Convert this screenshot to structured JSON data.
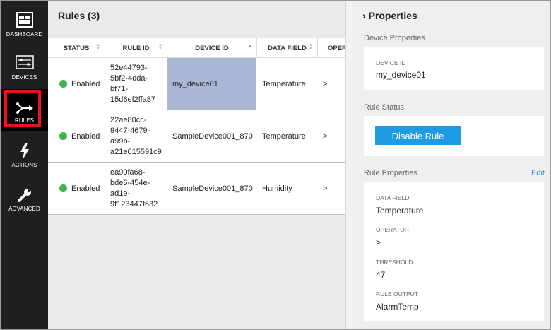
{
  "nav": {
    "items": [
      {
        "label": "DASHBOARD",
        "icon": "dashboard-icon"
      },
      {
        "label": "DEVICES",
        "icon": "devices-icon"
      },
      {
        "label": "RULES",
        "icon": "rules-icon",
        "active": true
      },
      {
        "label": "ACTIONS",
        "icon": "lightning-icon"
      },
      {
        "label": "ADVANCED",
        "icon": "wrench-icon"
      }
    ]
  },
  "main": {
    "title": "Rules (3)",
    "columns": [
      "STATUS",
      "RULE ID",
      "DEVICE ID",
      "DATA FIELD",
      "OPER"
    ],
    "rows": [
      {
        "status": "Enabled",
        "rule_id": "52e44793-\n5bf2-4dda-\nbf71-\n15d6ef2ffa87",
        "device_id": "my_device01",
        "data_field": "Temperature",
        "operator": ">"
      },
      {
        "status": "Enabled",
        "rule_id": "22ae80cc-\n9447-4679-\na99b-\na21e015591c9",
        "device_id": "SampleDevice001_870",
        "data_field": "Temperature",
        "operator": ">"
      },
      {
        "status": "Enabled",
        "rule_id": "ea90fa68-\nbde6-454e-\nad1e-\n9f123447f632",
        "device_id": "SampleDevice001_870",
        "data_field": "Humidity",
        "operator": ">"
      }
    ]
  },
  "props": {
    "title": "Properties",
    "device_section": "Device Properties",
    "device_id_label": "DEVICE ID",
    "device_id_value": "my_device01",
    "status_section": "Rule Status",
    "disable_button": "Disable Rule",
    "rule_section": "Rule Properties",
    "edit_link": "Edit",
    "fields": [
      {
        "label": "DATA FIELD",
        "value": "Temperature"
      },
      {
        "label": "OPERATOR",
        "value": ">"
      },
      {
        "label": "THRESHOLD",
        "value": "47"
      },
      {
        "label": "RULE OUTPUT",
        "value": "AlarmTemp"
      }
    ]
  },
  "colors": {
    "nav_bg": "#1f1f1f",
    "highlight": "#e8141c",
    "status_green": "#3fb34f",
    "selected_cell": "#aab8d6",
    "button_blue": "#1e9be3",
    "link_blue": "#2b8fd6"
  }
}
